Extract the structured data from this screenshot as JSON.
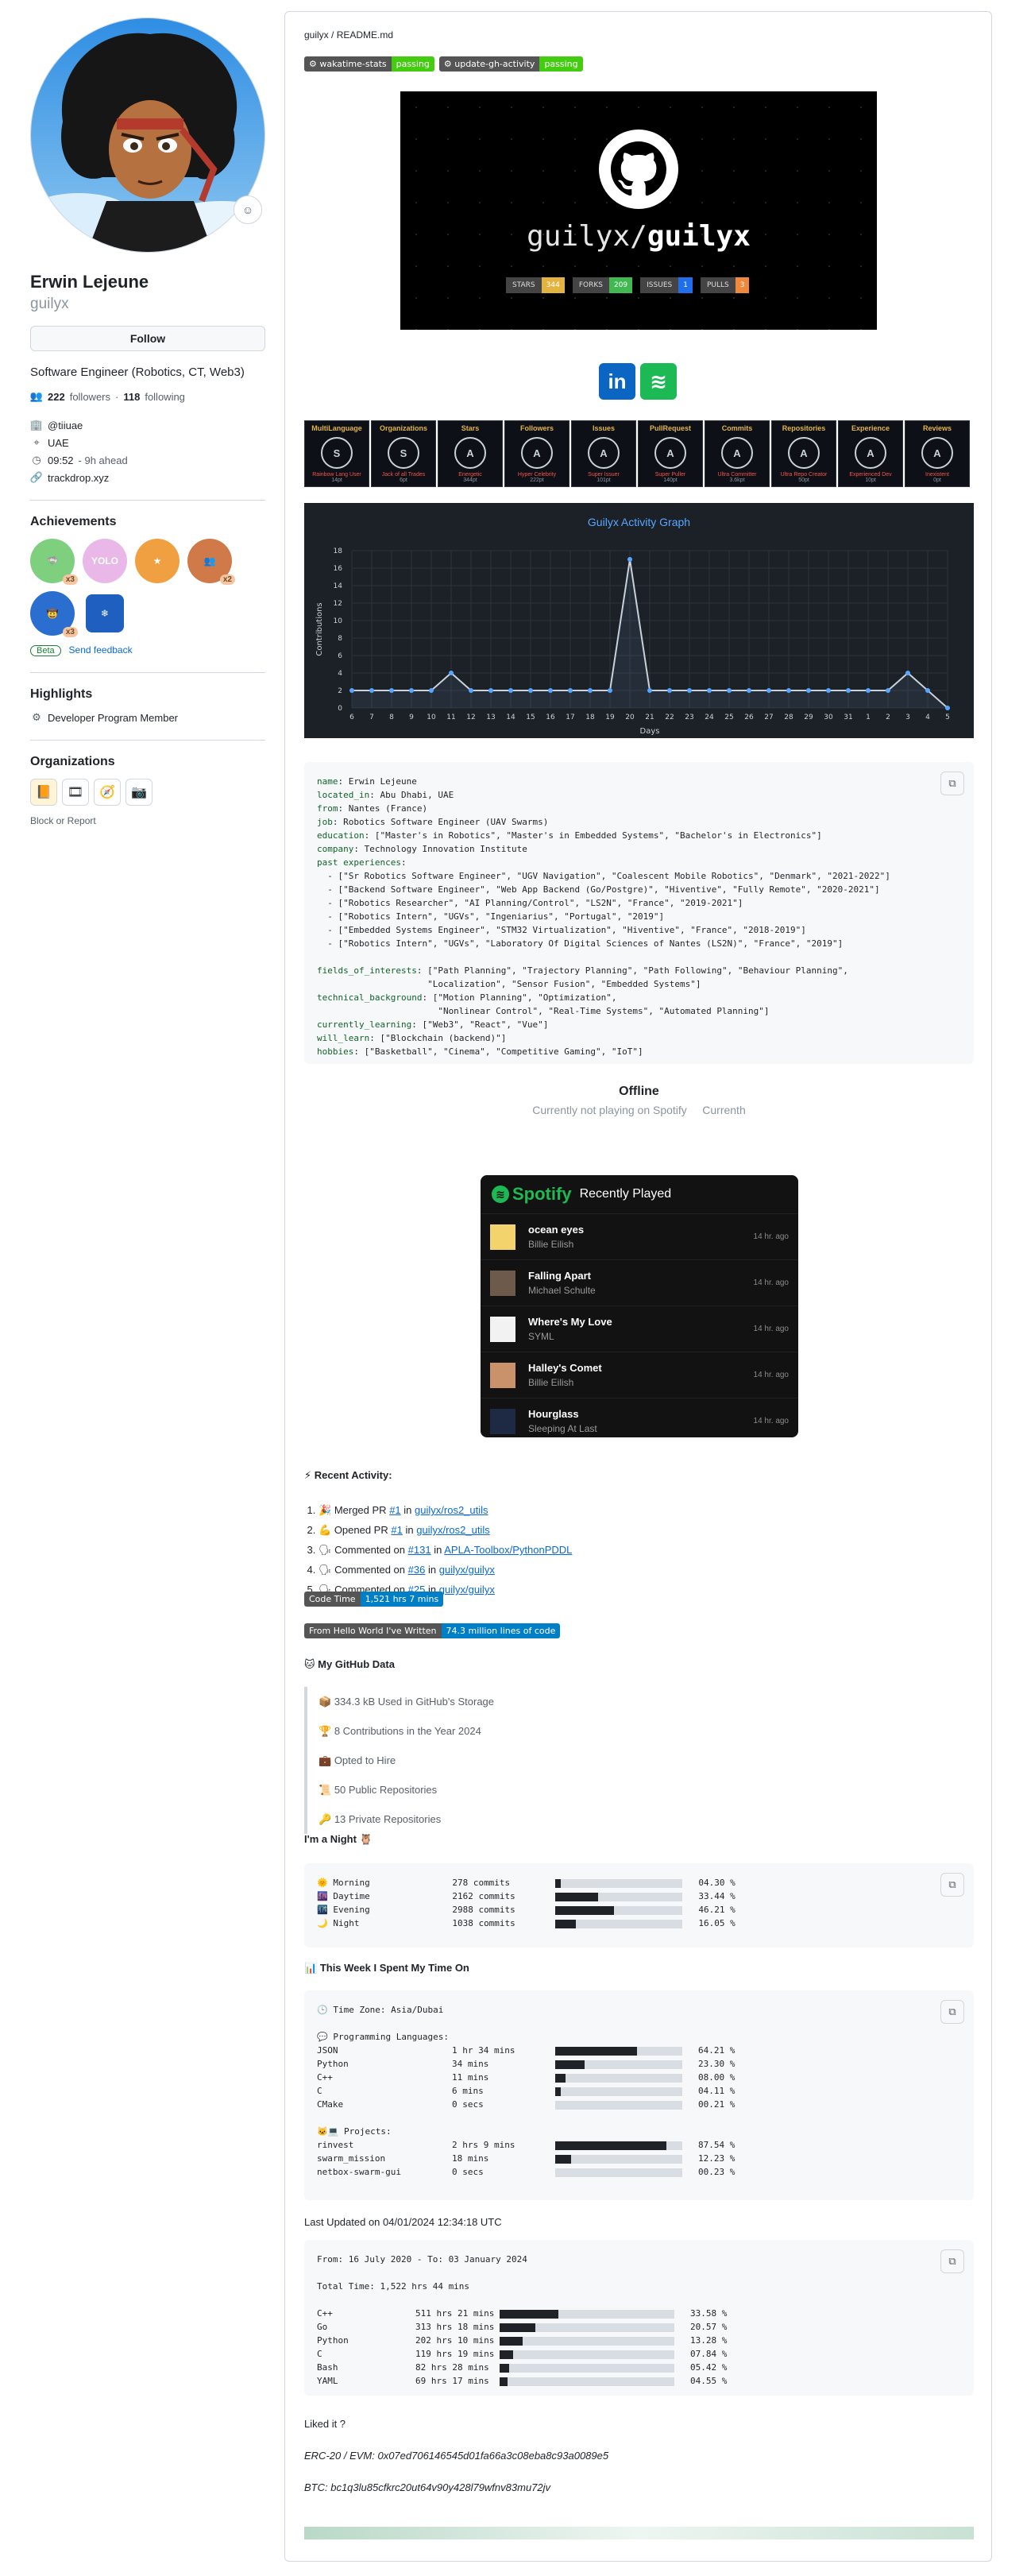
{
  "profile": {
    "name": "Erwin Lejeune",
    "login": "guilyx",
    "follow_label": "Follow",
    "bio": "Software Engineer (Robotics, CT, Web3)",
    "followers_count": "222",
    "followers_label": "followers",
    "following_count": "118",
    "following_label": "following",
    "company": "@tiiuae",
    "location": "UAE",
    "time": "09:52",
    "time_note": "- 9h ahead",
    "website": "trackdrop.xyz",
    "achievements_title": "Achievements",
    "achievements": [
      {
        "name": "pull-shark",
        "color": "#7ed07e",
        "mult": "x3"
      },
      {
        "name": "yolo",
        "color": "#e9b8e9",
        "mult": ""
      },
      {
        "name": "starstruck",
        "color": "#f0a040",
        "mult": ""
      },
      {
        "name": "pair-extraordinaire",
        "color": "#d07a4a",
        "mult": "x2"
      },
      {
        "name": "quickdraw",
        "color": "#2a6fd0",
        "mult": "x3"
      },
      {
        "name": "arctic-code-vault",
        "color": "#1f5fbf",
        "mult": ""
      }
    ],
    "beta_label": "Beta",
    "feedback_label": "Send feedback",
    "highlights_title": "Highlights",
    "highlight": "Developer Program Member",
    "orgs_title": "Organizations",
    "block_label": "Block or Report"
  },
  "readme": {
    "path_user": "guilyx",
    "path_sep": " / ",
    "path_file": "README.md",
    "badges": [
      {
        "left": "wakatime-stats",
        "right": "passing"
      },
      {
        "left": "update-gh-activity",
        "right": "passing"
      }
    ],
    "banner": {
      "user": "guilyx/",
      "repo": "guilyx",
      "stats": [
        {
          "k": "STARS",
          "v": "344",
          "color": "#e3b341"
        },
        {
          "k": "FORKS",
          "v": "209",
          "color": "#3fb950"
        },
        {
          "k": "ISSUES",
          "v": "1",
          "color": "#1f6feb"
        },
        {
          "k": "PULLS",
          "v": "3",
          "color": "#f0883e"
        }
      ]
    },
    "trophies": [
      {
        "title": "MultiLanguage",
        "rank": "S",
        "sub": "Rainbow Lang User",
        "val": "14pt"
      },
      {
        "title": "Organizations",
        "rank": "S",
        "sub": "Jack of all Trades",
        "val": "6pt"
      },
      {
        "title": "Stars",
        "rank": "A",
        "sub": "Energetic",
        "val": "344pt"
      },
      {
        "title": "Followers",
        "rank": "A",
        "sub": "Hyper Celebrity",
        "val": "222pt"
      },
      {
        "title": "Issues",
        "rank": "A",
        "sub": "Super Issuer",
        "val": "101pt"
      },
      {
        "title": "PullRequest",
        "rank": "A",
        "sub": "Super Puller",
        "val": "140pt"
      },
      {
        "title": "Commits",
        "rank": "A",
        "sub": "Ultra Committer",
        "val": "3.6kpt"
      },
      {
        "title": "Repositories",
        "rank": "A",
        "sub": "Ultra Repo Creator",
        "val": "50pt"
      },
      {
        "title": "Experience",
        "rank": "A",
        "sub": "Experienced Dev",
        "val": "10pt"
      },
      {
        "title": "Reviews",
        "rank": "A",
        "sub": "Inexistent",
        "val": "0pt"
      }
    ],
    "yaml_lines": [
      [
        "name",
        " Erwin Lejeune"
      ],
      [
        "located_in",
        " Abu Dhabi, UAE"
      ],
      [
        "from",
        " Nantes (France)"
      ],
      [
        "job",
        " Robotics Software Engineer (UAV Swarms)"
      ],
      [
        "education",
        " [\"Master's in Robotics\", \"Master's in Embedded Systems\", \"Bachelor's in Electronics\"]"
      ],
      [
        "company",
        " Technology Innovation Institute"
      ],
      [
        "past experiences",
        ""
      ],
      [
        "",
        "  - [\"Sr Robotics Software Engineer\", \"UGV Navigation\", \"Coalescent Mobile Robotics\", \"Denmark\", \"2021-2022\"]"
      ],
      [
        "",
        "  - [\"Backend Software Engineer\", \"Web App Backend (Go/Postgre)\", \"Hiventive\", \"Fully Remote\", \"2020-2021\"]"
      ],
      [
        "",
        "  - [\"Robotics Researcher\", \"AI Planning/Control\", \"LS2N\", \"France\", \"2019-2021\"]"
      ],
      [
        "",
        "  - [\"Robotics Intern\", \"UGVs\", \"Ingeniarius\", \"Portugal\", \"2019\"]"
      ],
      [
        "",
        "  - [\"Embedded Systems Engineer\", \"STM32 Virtualization\", \"Hiventive\", \"France\", \"2018-2019\"]"
      ],
      [
        "",
        "  - [\"Robotics Intern\", \"UGVs\", \"Laboratory Of Digital Sciences of Nantes (LS2N)\", \"France\", \"2019\"]"
      ],
      [
        "",
        ""
      ],
      [
        "fields_of_interests",
        " [\"Path Planning\", \"Trajectory Planning\", \"Path Following\", \"Behaviour Planning\","
      ],
      [
        "",
        "                     \"Localization\", \"Sensor Fusion\", \"Embedded Systems\"]"
      ],
      [
        "technical_background",
        " [\"Motion Planning\", \"Optimization\","
      ],
      [
        "",
        "                       \"Nonlinear Control\", \"Real-Time Systems\", \"Automated Planning\"]"
      ],
      [
        "currently_learning",
        " [\"Web3\", \"React\", \"Vue\"]"
      ],
      [
        "will_learn",
        " [\"Blockchain (backend)\"]"
      ],
      [
        "hobbies",
        " [\"Basketball\", \"Cinema\", \"Competitive Gaming\", \"IoT\"]"
      ]
    ],
    "offline_title": "Offline",
    "offline_sub": "Currently not playing on Spotify",
    "offline_sub2": "Currenth",
    "spotify": {
      "brand": "Spotify",
      "title": "Recently Played",
      "tracks": [
        {
          "name": "ocean eyes",
          "artist": "Billie Eilish",
          "ago": "14 hr. ago",
          "color": "#f3d36b"
        },
        {
          "name": "Falling Apart",
          "artist": "Michael Schulte",
          "ago": "14 hr. ago",
          "color": "#6d5a4a"
        },
        {
          "name": "Where's My Love",
          "artist": "SYML",
          "ago": "14 hr. ago",
          "color": "#f2f2f2"
        },
        {
          "name": "Halley's Comet",
          "artist": "Billie Eilish",
          "ago": "14 hr. ago",
          "color": "#c9926b"
        },
        {
          "name": "Hourglass",
          "artist": "Sleeping At Last",
          "ago": "14 hr. ago",
          "color": "#1e2a44"
        }
      ]
    },
    "recent_title": "Recent Activity:",
    "recent": [
      {
        "icon": "🎉",
        "verb": "Merged PR",
        "ref": "#1",
        "in": "in",
        "repo": "guilyx/ros2_utils"
      },
      {
        "icon": "💪",
        "verb": "Opened PR",
        "ref": "#1",
        "in": "in",
        "repo": "guilyx/ros2_utils"
      },
      {
        "icon": "🗣",
        "verb": "Commented on",
        "ref": "#131",
        "in": "in",
        "repo": "APLA-Toolbox/PythonPDDL"
      },
      {
        "icon": "🗣",
        "verb": "Commented on",
        "ref": "#36",
        "in": "in",
        "repo": "guilyx/guilyx"
      },
      {
        "icon": "🗣",
        "verb": "Commented on",
        "ref": "#25",
        "in": "in",
        "repo": "guilyx/guilyx"
      }
    ],
    "code_time": {
      "l": "Code Time",
      "r": "1,521 hrs 7 mins"
    },
    "lines_written": {
      "l": "From Hello World I've Written",
      "r": "74.3 million lines of code"
    },
    "ghdata_title": "My GitHub Data",
    "ghdata": [
      {
        "icon": "📦",
        "text": "334.3 kB Used in GitHub's Storage"
      },
      {
        "icon": "🏆",
        "text": "8 Contributions in the Year 2024"
      },
      {
        "icon": "💼",
        "text": "Opted to Hire"
      },
      {
        "icon": "📜",
        "text": "50 Public Repositories"
      },
      {
        "icon": "🔑",
        "text": "13 Private Repositories"
      }
    ],
    "night_title": "I'm a Night 🦉",
    "night": [
      {
        "icon": "🌞",
        "label": "Morning",
        "commits": "278 commits",
        "pct": 4.3,
        "pct_text": "04.30 %"
      },
      {
        "icon": "🌆",
        "label": "Daytime",
        "commits": "2162 commits",
        "pct": 33.44,
        "pct_text": "33.44 %"
      },
      {
        "icon": "🌃",
        "label": "Evening",
        "commits": "2988 commits",
        "pct": 46.21,
        "pct_text": "46.21 %"
      },
      {
        "icon": "🌙",
        "label": "Night",
        "commits": "1038 commits",
        "pct": 16.05,
        "pct_text": "16.05 %"
      }
    ],
    "week_title": "This Week I Spent My Time On",
    "week_tz": "Time Zone: Asia/Dubai",
    "week_lang_title": "Programming Languages:",
    "week_langs": [
      {
        "label": "JSON",
        "time": "1 hr 34 mins",
        "pct": 64.21,
        "pct_text": "64.21 %"
      },
      {
        "label": "Python",
        "time": "34 mins",
        "pct": 23.3,
        "pct_text": "23.30 %"
      },
      {
        "label": "C++",
        "time": "11 mins",
        "pct": 8.0,
        "pct_text": "08.00 %"
      },
      {
        "label": "C",
        "time": "6 mins",
        "pct": 4.11,
        "pct_text": "04.11 %"
      },
      {
        "label": "CMake",
        "time": "0 secs",
        "pct": 0.21,
        "pct_text": "00.21 %"
      }
    ],
    "week_proj_title": "Projects:",
    "week_projects": [
      {
        "label": "rinvest",
        "time": "2 hrs 9 mins",
        "pct": 87.54,
        "pct_text": "87.54 %"
      },
      {
        "label": "swarm_mission",
        "time": "18 mins",
        "pct": 12.23,
        "pct_text": "12.23 %"
      },
      {
        "label": "netbox-swarm-gui",
        "time": "0 secs",
        "pct": 0.23,
        "pct_text": "00.23 %"
      }
    ],
    "last_updated": "Last Updated on 04/01/2024 12:34:18 UTC",
    "alltime_range": "From: 16 July 2020 - To: 03 January 2024",
    "alltime_total": "Total Time: 1,522 hrs 44 mins",
    "alltime": [
      {
        "label": "C++",
        "time": "511 hrs 21 mins",
        "pct": 33.58,
        "pct_text": "33.58 %"
      },
      {
        "label": "Go",
        "time": "313 hrs 18 mins",
        "pct": 20.57,
        "pct_text": "20.57 %"
      },
      {
        "label": "Python",
        "time": "202 hrs 10 mins",
        "pct": 13.28,
        "pct_text": "13.28 %"
      },
      {
        "label": "C",
        "time": "119 hrs 19 mins",
        "pct": 7.84,
        "pct_text": "07.84 %"
      },
      {
        "label": "Bash",
        "time": "82 hrs 28 mins",
        "pct": 5.42,
        "pct_text": "05.42 %"
      },
      {
        "label": "YAML",
        "time": "69 hrs 17 mins",
        "pct": 4.55,
        "pct_text": "04.55 %"
      }
    ],
    "liked_it": "Liked it ?",
    "erc20": "ERC-20 / EVM: 0x07ed706146545d01fa66a3c08eba8c93a0089e5",
    "btc": "BTC: bc1q3lu85cfkrc20ut64v90y428l79wfnv83mu72jv"
  },
  "chart_data": {
    "type": "line",
    "title": "Guilyx Activity Graph",
    "xlabel": "Days",
    "ylabel": "Contributions",
    "x": [
      "6",
      "7",
      "8",
      "9",
      "10",
      "11",
      "12",
      "13",
      "14",
      "15",
      "16",
      "17",
      "18",
      "19",
      "20",
      "21",
      "22",
      "23",
      "24",
      "25",
      "26",
      "27",
      "28",
      "29",
      "30",
      "31",
      "1",
      "2",
      "3",
      "4",
      "5"
    ],
    "series": [
      {
        "values": [
          2,
          2,
          2,
          2,
          2,
          4,
          2,
          2,
          2,
          2,
          2,
          2,
          2,
          2,
          17,
          2,
          2,
          2,
          2,
          2,
          2,
          2,
          2,
          2,
          2,
          2,
          2,
          2,
          4,
          2,
          0
        ]
      }
    ],
    "ylim": [
      0,
      18
    ],
    "yticks": [
      0,
      2,
      4,
      6,
      8,
      10,
      12,
      14,
      16,
      18
    ],
    "grid": true
  }
}
